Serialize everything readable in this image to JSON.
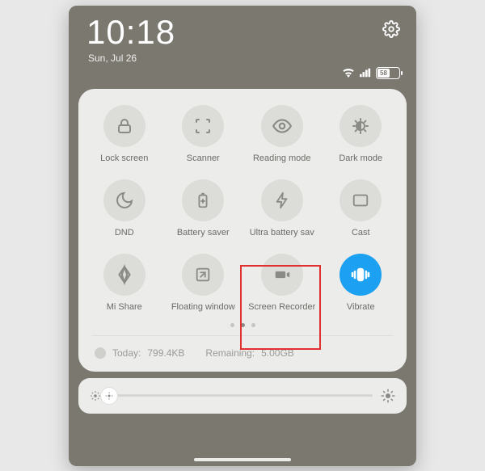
{
  "status": {
    "time": "10:18",
    "date": "Sun, Jul 26",
    "battery_pct": "58"
  },
  "tiles": [
    {
      "label": "Lock screen",
      "icon": "lock-icon",
      "active": false
    },
    {
      "label": "Scanner",
      "icon": "scanner-icon",
      "active": false
    },
    {
      "label": "Reading mode",
      "icon": "eye-icon",
      "active": false
    },
    {
      "label": "Dark mode",
      "icon": "dark-mode-icon",
      "active": false
    },
    {
      "label": "DND",
      "icon": "moon-icon",
      "active": false
    },
    {
      "label": "Battery saver",
      "icon": "battery-plus-icon",
      "active": false
    },
    {
      "label": "Ultra battery sav",
      "icon": "bolt-icon",
      "active": false
    },
    {
      "label": "Cast",
      "icon": "cast-icon",
      "active": false
    },
    {
      "label": "Mi Share",
      "icon": "mishare-icon",
      "active": false
    },
    {
      "label": "Floating window",
      "icon": "floating-window-icon",
      "active": false
    },
    {
      "label": "Screen Recorder",
      "icon": "camera-icon",
      "active": false,
      "highlight": true
    },
    {
      "label": "Vibrate",
      "icon": "vibrate-icon",
      "active": true
    }
  ],
  "pager": {
    "count": 3,
    "active": 1
  },
  "data_usage": {
    "today_label": "Today:",
    "today_value": "799.4KB",
    "remaining_label": "Remaining:",
    "remaining_value": "5.00GB"
  }
}
